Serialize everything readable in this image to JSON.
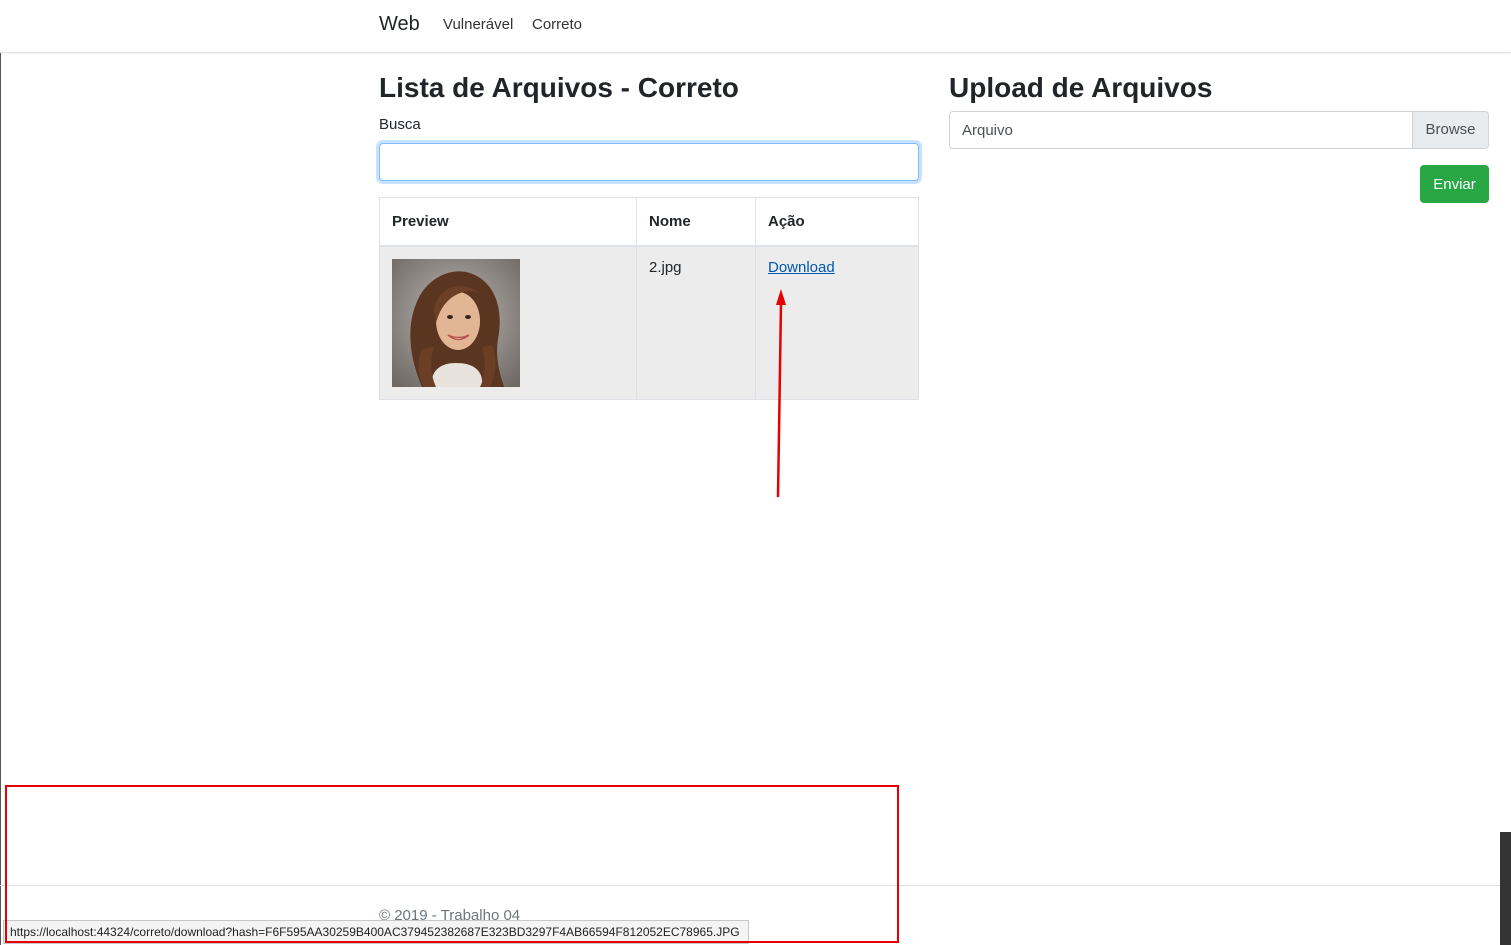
{
  "navbar": {
    "brand": "Web",
    "links": [
      "Vulnerável",
      "Correto"
    ]
  },
  "list_section": {
    "title": "Lista de Arquivos - Correto",
    "search_label": "Busca",
    "search_value": "",
    "table": {
      "headers": [
        "Preview",
        "Nome",
        "Ação"
      ],
      "rows": [
        {
          "name": "2.jpg",
          "action": "Download"
        }
      ]
    }
  },
  "upload_section": {
    "title": "Upload de Arquivos",
    "file_placeholder": "Arquivo",
    "browse_label": "Browse",
    "submit_label": "Enviar"
  },
  "footer": {
    "text": "© 2019 - Trabalho 04"
  },
  "status_bar": {
    "url": "https://localhost:44324/correto/download?hash=F6F595AA30259B400AC379452382687E323BD3297F4AB66594F812052EC78965.JPG"
  },
  "colors": {
    "submit_button": "#28a745",
    "link": "#0056b3",
    "annotation": "#e60000"
  }
}
